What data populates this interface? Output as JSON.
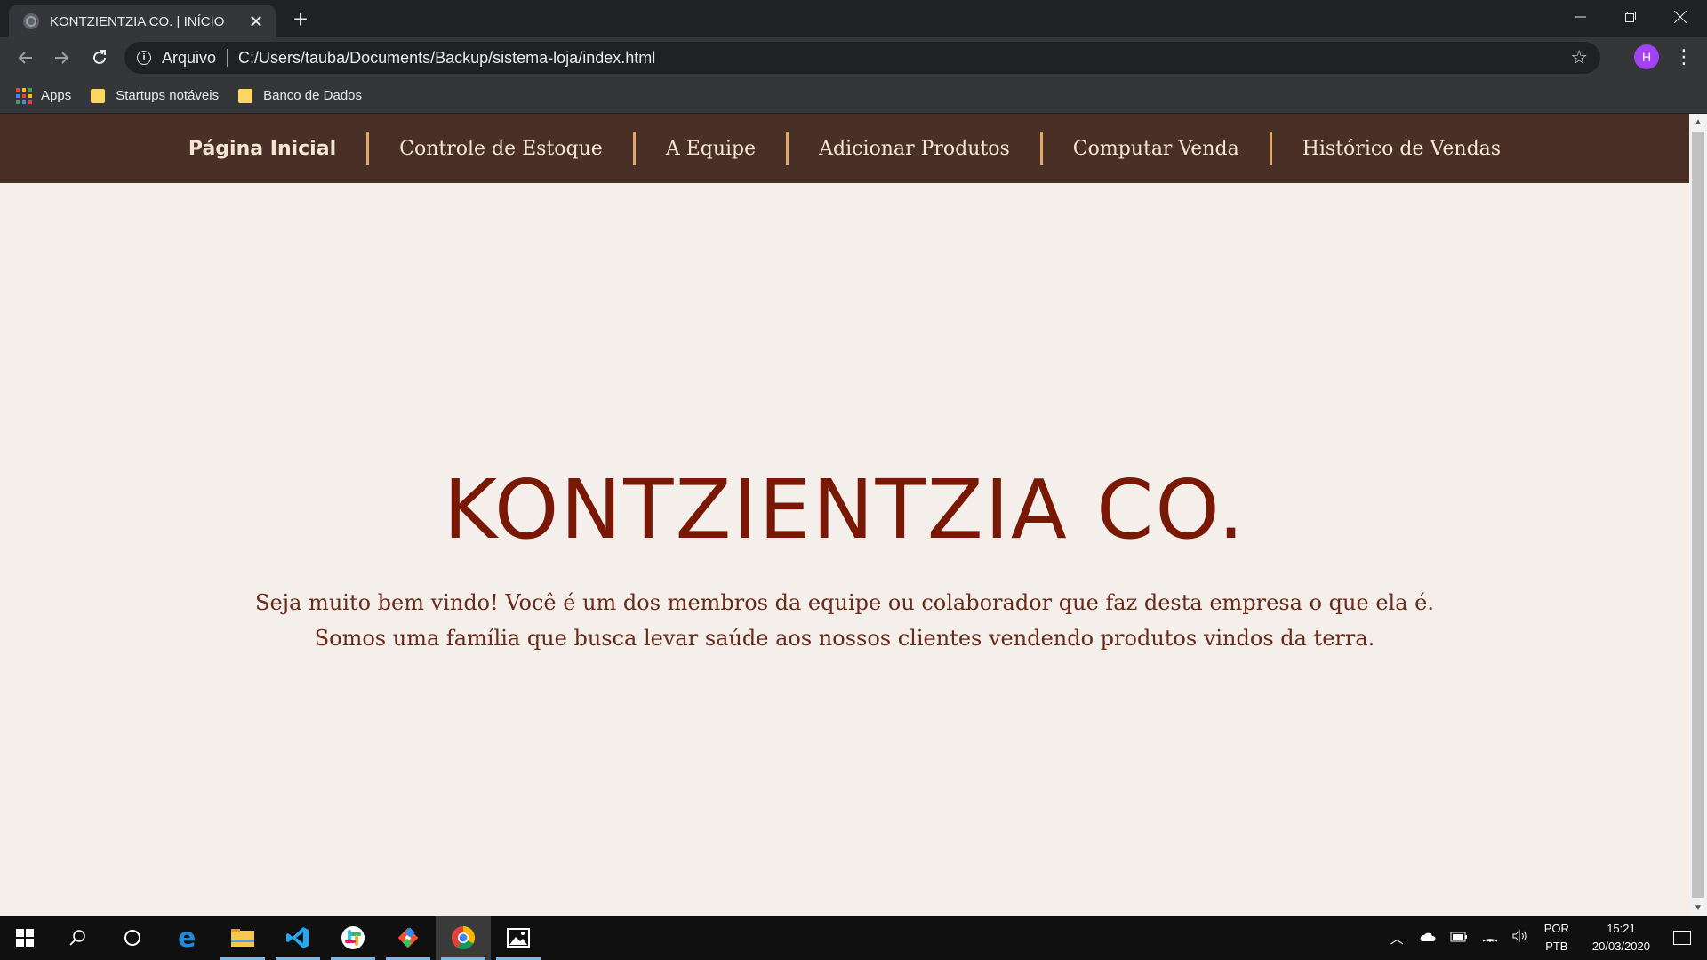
{
  "browser": {
    "tab_title": "KONTZIENTZIA CO. | INÍCIO",
    "tab_close": "✕",
    "new_tab": "+",
    "scheme_label": "Arquivo",
    "url": "C:/Users/tauba/Documents/Backup/sistema-loja/index.html",
    "profile_initial": "H",
    "bookmarks": {
      "apps": "Apps",
      "items": [
        "Startups notáveis",
        "Banco de Dados"
      ]
    },
    "profile_color": "#a142f4"
  },
  "site": {
    "nav": [
      "Página Inicial",
      "Controle de Estoque",
      "A Equipe",
      "Adicionar Produtos",
      "Computar Venda",
      "Histórico de Vendas"
    ],
    "hero": {
      "title": "KONTZIENTZIA CO.",
      "line1": "Seja muito bem vindo! Você é um dos membros da equipe ou colaborador que faz desta empresa o que ela é.",
      "line2": "Somos uma família que busca levar saúde aos nossos clientes vendendo produtos vindos da terra."
    },
    "colors": {
      "nav_bg": "#4a2f26",
      "page_bg": "#f4efea",
      "title": "#7a1806",
      "divider": "#e0a868"
    }
  },
  "taskbar": {
    "apps": [
      "start-icon",
      "search-icon",
      "cortana-icon",
      "edge-icon",
      "file-explorer-icon",
      "vscode-icon",
      "slack-icon",
      "git-icon",
      "chrome-icon",
      "photos-icon"
    ],
    "lang_top": "POR",
    "lang_bottom": "PTB",
    "time": "15:21",
    "date": "20/03/2020"
  }
}
